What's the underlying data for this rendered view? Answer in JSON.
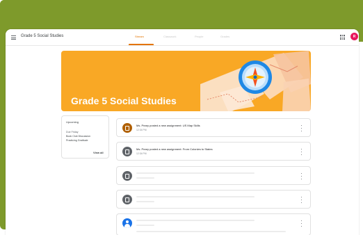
{
  "colors": {
    "frame_green": "#7e9a2b",
    "banner_orange": "#f9a825",
    "accent_orange": "#e37400",
    "avatar_pink": "#e8175d",
    "icon_gray": "#5f6368",
    "icon_brown": "#b06000",
    "person_blue": "#1a73e8"
  },
  "header": {
    "class_title": "Grade 5 Social Studies",
    "menu_icon": "hamburger-menu-icon",
    "apps_icon": "apps-grid-icon",
    "avatar_initial": "R",
    "tabs": [
      {
        "label": "Stream",
        "active": true
      },
      {
        "label": "Classwork",
        "active": false
      },
      {
        "label": "People",
        "active": false
      },
      {
        "label": "Grades",
        "active": false
      }
    ]
  },
  "banner": {
    "title": "Grade 5 Social Studies",
    "illustration": "compass-map-illustration"
  },
  "upcoming": {
    "heading": "Upcoming",
    "due": "Due Friday",
    "items": [
      "Book Club Discussion",
      "Practicing Gratitude"
    ],
    "view_all": "View all"
  },
  "feed": [
    {
      "title": "Ms. Peary posted a new assignment: US Map Skills",
      "time": "12:34 PM",
      "icon": "assignment-icon"
    },
    {
      "title": "Ms. Peary posted a new assignment: From Colonies to States",
      "time": "12:34 PM",
      "icon": "assignment-icon"
    },
    {
      "title": "",
      "time": "",
      "icon": "assignment-icon"
    },
    {
      "title": "",
      "time": "",
      "icon": "assignment-icon"
    },
    {
      "title": "",
      "time": "",
      "icon": "person-icon"
    }
  ]
}
